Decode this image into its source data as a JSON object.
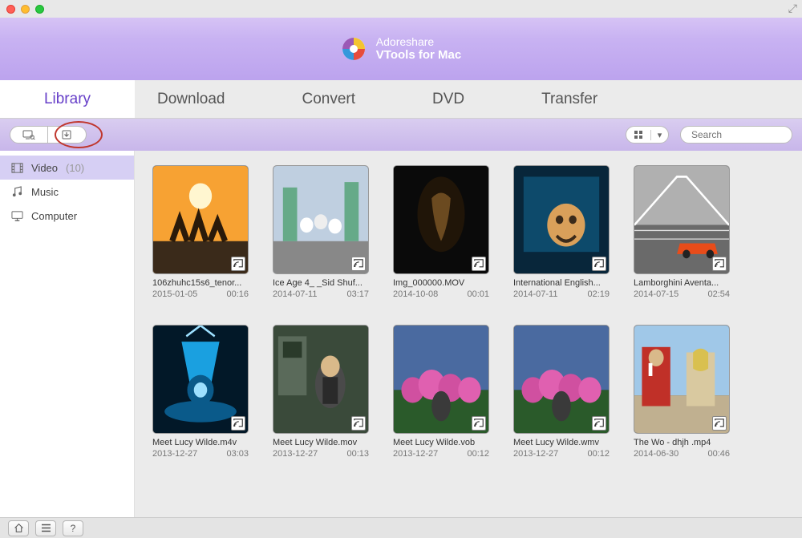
{
  "brand": {
    "line1": "Adoreshare",
    "line2": "VTools for Mac"
  },
  "tabs": {
    "library": "Library",
    "download": "Download",
    "convert": "Convert",
    "dvd": "DVD",
    "transfer": "Transfer"
  },
  "search": {
    "placeholder": "Search"
  },
  "sidebar": {
    "items": [
      {
        "label": "Video",
        "count": "(10)"
      },
      {
        "label": "Music"
      },
      {
        "label": "Computer"
      }
    ]
  },
  "videos": [
    {
      "name": "106zhuhc15s6_tenor...",
      "date": "2015-01-05",
      "dur": "00:16"
    },
    {
      "name": "Ice Age 4_ _Sid Shuf...",
      "date": "2014-07-11",
      "dur": "03:17"
    },
    {
      "name": "Img_000000.MOV",
      "date": "2014-10-08",
      "dur": "00:01"
    },
    {
      "name": "International English...",
      "date": "2014-07-11",
      "dur": "02:19"
    },
    {
      "name": "Lamborghini Aventa...",
      "date": "2014-07-15",
      "dur": "02:54"
    },
    {
      "name": "Meet Lucy Wilde.m4v",
      "date": "2013-12-27",
      "dur": "03:03"
    },
    {
      "name": "Meet Lucy Wilde.mov",
      "date": "2013-12-27",
      "dur": "00:13"
    },
    {
      "name": "Meet Lucy Wilde.vob",
      "date": "2013-12-27",
      "dur": "00:12"
    },
    {
      "name": "Meet Lucy Wilde.wmv",
      "date": "2013-12-27",
      "dur": "00:12"
    },
    {
      "name": "The Wo - dhjh .mp4",
      "date": "2014-06-30",
      "dur": "00:46"
    }
  ]
}
